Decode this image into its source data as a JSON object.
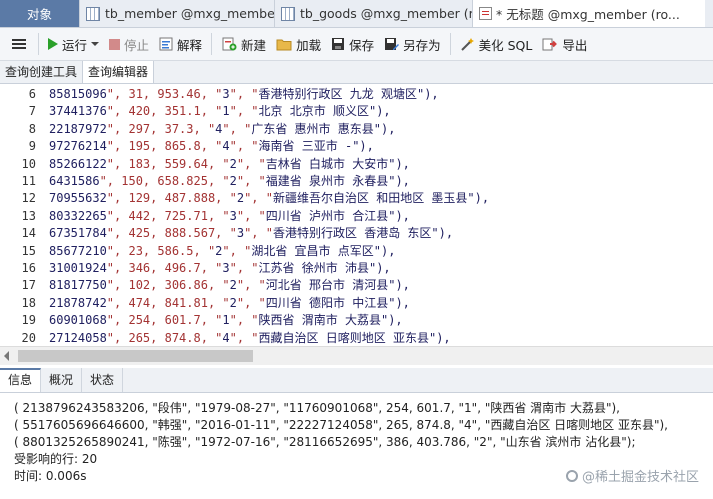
{
  "tabs": [
    {
      "label": "对象"
    },
    {
      "label": "tb_member @mxg_member..."
    },
    {
      "label": "tb_goods @mxg_member (r..."
    },
    {
      "label": "* 无标题 @mxg_member (ro..."
    }
  ],
  "toolbar": {
    "run": "运行",
    "stop": "停止",
    "explain": "解释",
    "new": "新建",
    "load": "加载",
    "save": "保存",
    "save_as": "另存为",
    "beautify": "美化 SQL",
    "export": "导出"
  },
  "subtabs": [
    "查询创建工具",
    "查询编辑器"
  ],
  "editor_lines": [
    {
      "n": "6",
      "code": "85815096\", 31, 953.46, \"3\", \"香港特别行政区 九龙 观塘区\"),"
    },
    {
      "n": "7",
      "code": "37441376\", 420, 351.1, \"1\", \"北京 北京市 顺义区\"),"
    },
    {
      "n": "8",
      "code": "22187972\", 297, 37.3, \"4\", \"广东省 惠州市 惠东县\"),"
    },
    {
      "n": "9",
      "code": "97276214\", 195, 865.8, \"4\", \"海南省 三亚市 -\"),"
    },
    {
      "n": "10",
      "code": "85266122\", 183, 559.64, \"2\", \"吉林省 白城市 大安市\"),"
    },
    {
      "n": "11",
      "code": "6431586\", 150, 658.825, \"2\", \"福建省 泉州市 永春县\"),"
    },
    {
      "n": "12",
      "code": "70955632\", 129, 487.888, \"2\", \"新疆维吾尔自治区 和田地区 墨玉县\"),"
    },
    {
      "n": "13",
      "code": "80332265\", 442, 725.71, \"3\", \"四川省 泸州市 合江县\"),"
    },
    {
      "n": "14",
      "code": "67351784\", 425, 888.567, \"3\", \"香港特别行政区 香港岛 东区\"),"
    },
    {
      "n": "15",
      "code": "85677210\", 23, 586.5, \"2\", \"湖北省 宜昌市 点军区\"),"
    },
    {
      "n": "16",
      "code": "31001924\", 346, 496.7, \"3\", \"江苏省 徐州市 沛县\"),"
    },
    {
      "n": "17",
      "code": "81817750\", 102, 306.86, \"2\", \"河北省 邢台市 清河县\"),"
    },
    {
      "n": "18",
      "code": "21878742\", 474, 841.81, \"2\", \"四川省 德阳市 中江县\"),"
    },
    {
      "n": "19",
      "code": "60901068\", 254, 601.7, \"1\", \"陕西省 渭南市 大荔县\"),"
    },
    {
      "n": "20",
      "code": "27124058\", 265, 874.8, \"4\", \"西藏自治区 日喀则地区 亚东县\"),"
    },
    {
      "n": "21",
      "code": "16652695\", 386, 403.786, \"2\", \"山东省 滨州市 沾化县\");"
    }
  ],
  "bottom_tabs": [
    "信息",
    "概况",
    "状态"
  ],
  "info_lines": [
    "( 2138796243583206, \"段伟\", \"1979-08-27\", \"11760901068\", 254, 601.7, \"1\", \"陕西省 渭南市 大荔县\"),",
    "( 5517605696646600, \"韩强\", \"2016-01-11\", \"22227124058\", 265, 874.8, \"4\", \"西藏自治区 日喀则地区 亚东县\"),",
    "( 8801325265890241, \"陈强\", \"1972-07-16\", \"28116652695\", 386, 403.786, \"2\", \"山东省 滨州市 沾化县\");",
    "受影响的行: 20",
    "时间: 0.006s"
  ],
  "watermark": "@稀土掘金技术社区"
}
